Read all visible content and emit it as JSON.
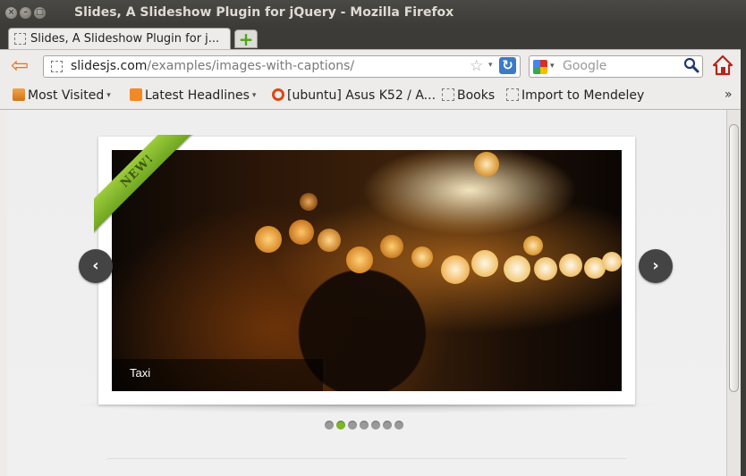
{
  "window": {
    "title": "Slides, A Slideshow Plugin for jQuery - Mozilla Firefox",
    "close_glyph": "×",
    "min_glyph": "–",
    "max_glyph": "□"
  },
  "tabs": [
    {
      "label": "Slides, A Slideshow Plugin for j..."
    }
  ],
  "new_tab_glyph": "+",
  "toolbar": {
    "back_glyph": "⇦",
    "url_host": "slidesjs.com",
    "url_path": "/examples/images-with-captions/",
    "star_glyph": "☆",
    "dropdown_glyph": "▾",
    "reload_glyph": "↻"
  },
  "search": {
    "placeholder": "Google",
    "engine_dropdown_glyph": "▾",
    "search_glyph": "🔍"
  },
  "bookmarks": [
    {
      "label": "Most Visited",
      "icon": "folder-icon",
      "dropdown": "▾"
    },
    {
      "label": "Latest Headlines",
      "icon": "rss-icon",
      "dropdown": "▾"
    },
    {
      "label": "[ubuntu] Asus K52 / A...",
      "icon": "ubuntu-icon"
    },
    {
      "label": "Books",
      "icon": "page-icon"
    },
    {
      "label": "Import to Mendeley",
      "icon": "page-icon"
    }
  ],
  "bookmarks_more": "»",
  "slideshow": {
    "ribbon_text": "NEW!",
    "caption": "Taxi",
    "prev_glyph": "‹",
    "next_glyph": "›",
    "slide_count": 7,
    "active_slide": 2
  },
  "colors": {
    "accent_green": "#7cb52a",
    "firefox_back_orange": "#e8731c"
  }
}
